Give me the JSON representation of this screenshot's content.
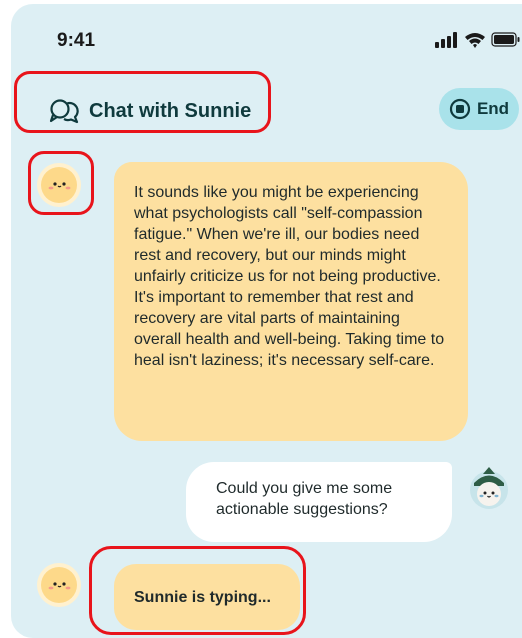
{
  "status_bar": {
    "time": "9:41"
  },
  "header": {
    "title": "Chat with Sunnie",
    "end_label": "End"
  },
  "messages": [
    {
      "sender": "Sunnie",
      "text": "It sounds like you might be experiencing what psychologists call \"self-compassion fatigue.\" When we're ill, our bodies need rest and recovery, but our minds might unfairly criticize us for not being productive. It's important to remember that rest and recovery are vital parts of maintaining overall health and well-being. Taking time to heal isn't laziness; it's necessary self-care."
    },
    {
      "sender": "user",
      "text": "Could you give me some actionable suggestions?"
    }
  ],
  "typing_indicator": "Sunnie is typing...",
  "colors": {
    "background": "#ddeff4",
    "bot_bubble": "#fde0a0",
    "user_bubble": "#ffffff",
    "end_button": "#a9e2ea",
    "highlight": "#e8141b",
    "title_text": "#0f3a3d"
  },
  "icons": {
    "chat": "chat-bubbles-icon",
    "end": "stop-circle-icon",
    "signal": "signal-bars-icon",
    "wifi": "wifi-icon",
    "battery": "battery-icon"
  }
}
